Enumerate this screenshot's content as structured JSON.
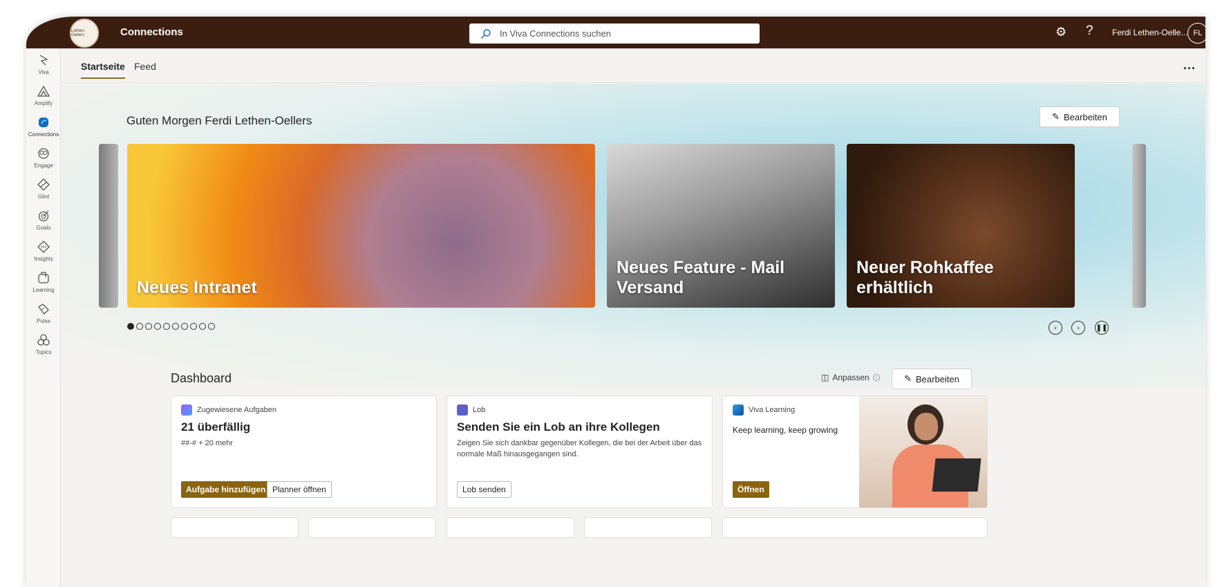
{
  "topbar": {
    "logo_text": "Lethen-Oellers",
    "app_title": "Connections",
    "search_placeholder": "In Viva Connections suchen",
    "user_name": "Ferdi Lethen-Oelle...",
    "user_initials": "FL"
  },
  "rail": {
    "items": [
      {
        "label": "Viva"
      },
      {
        "label": "Amplify"
      },
      {
        "label": "Connections"
      },
      {
        "label": "Engage"
      },
      {
        "label": "Glint"
      },
      {
        "label": "Goals"
      },
      {
        "label": "Insights"
      },
      {
        "label": "Learning"
      },
      {
        "label": "Pulse"
      },
      {
        "label": "Topics"
      }
    ]
  },
  "tabs": {
    "items": [
      {
        "label": "Startseite",
        "active": true
      },
      {
        "label": "Feed",
        "active": false
      }
    ],
    "more_label": "..."
  },
  "hero": {
    "greeting": "Guten Morgen Ferdi Lethen-Oellers",
    "edit_label": "Bearbeiten",
    "cards": [
      {
        "title": "Neues Intranet"
      },
      {
        "title": "Neues Feature - Mail Versand"
      },
      {
        "title": "Neuer Rohkaffee erhältlich"
      }
    ],
    "page_count": 10,
    "active_page": 1
  },
  "dashboard": {
    "title": "Dashboard",
    "anpassen_label": "Anpassen",
    "edit_label": "Bearbeiten",
    "cards": [
      {
        "head": "Zugewiesene Aufgaben",
        "big": "21 überfällig",
        "sub": "##-# + 20 mehr",
        "primary": "Aufgabe hinzufügen",
        "secondary": "Planner öffnen",
        "icon_color": "#7b4fd1"
      },
      {
        "head": "Lob",
        "big": "Senden Sie ein Lob an ihre Kollegen",
        "sub": "Zeigen Sie sich dankbar gegenüber Kollegen, die bei der Arbeit über das normale Maß hinausgegangen sind.",
        "secondary": "Lob senden",
        "icon_color": "#5b5fc7"
      },
      {
        "head": "Viva Learning",
        "big": "Keep learning, keep growing",
        "primary": "Öffnen",
        "icon_color": "#0f6cbd"
      }
    ]
  },
  "colors": {
    "topbar": "#3b1e0f",
    "accent": "#8a6410"
  }
}
